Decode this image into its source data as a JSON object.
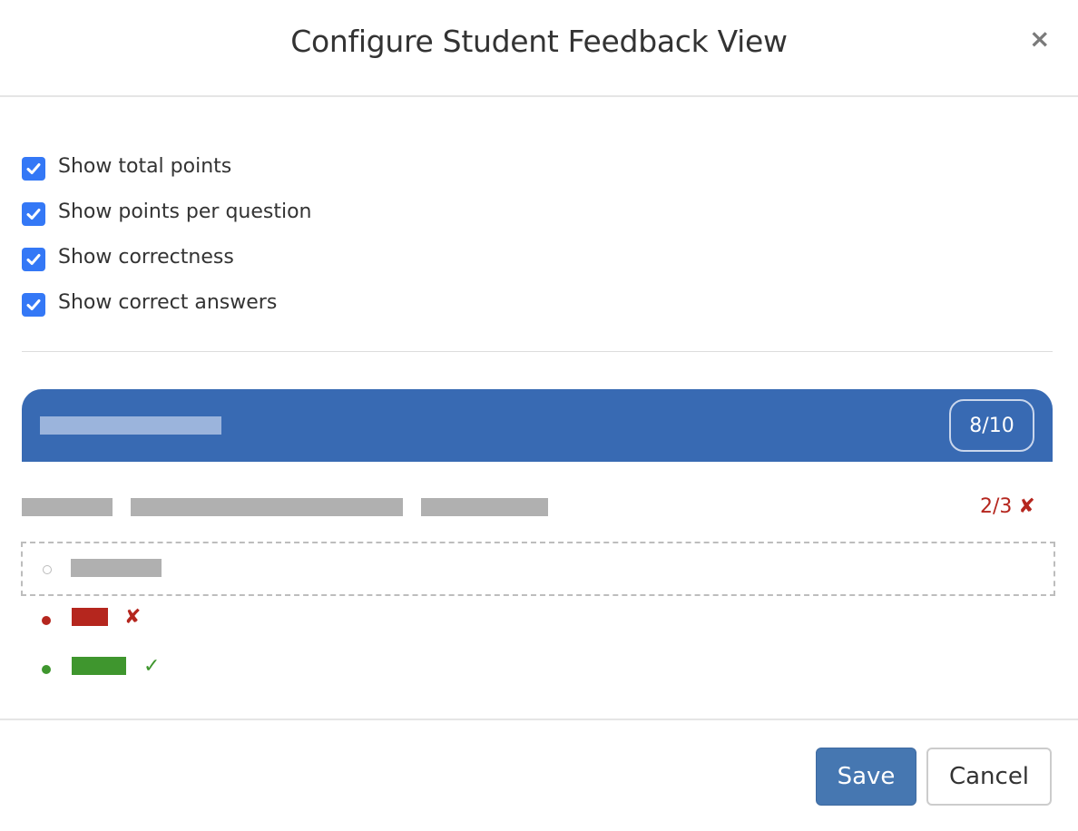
{
  "dialog": {
    "title": "Configure Student Feedback View",
    "close_icon": "×"
  },
  "options": [
    {
      "label": "Show total points",
      "checked": true
    },
    {
      "label": "Show points per question",
      "checked": true
    },
    {
      "label": "Show correctness",
      "checked": true
    },
    {
      "label": "Show correct answers",
      "checked": true
    }
  ],
  "preview": {
    "total_score": "8/10",
    "question_score": "2/3",
    "question_mark": "✘",
    "incorrect_mark": "✘",
    "correct_mark": "✓",
    "colors": {
      "banner": "#386ab3",
      "incorrect": "#b5261e",
      "correct": "#3f962e",
      "placeholder": "#b0b0b0"
    }
  },
  "footer": {
    "save_label": "Save",
    "cancel_label": "Cancel"
  }
}
